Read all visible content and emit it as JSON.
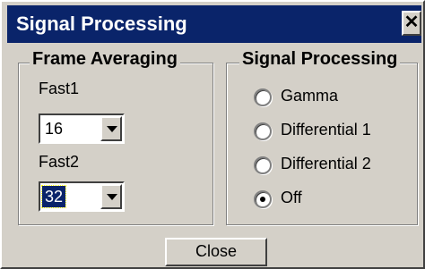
{
  "window": {
    "title": "Signal Processing",
    "close_glyph": "✕"
  },
  "frame_averaging": {
    "legend": "Frame Averaging",
    "fast1": {
      "label": "Fast1",
      "value": "16"
    },
    "fast2": {
      "label": "Fast2",
      "value": "32"
    }
  },
  "signal_processing": {
    "legend": "Signal Processing",
    "options": [
      {
        "label": "Gamma",
        "selected": false
      },
      {
        "label": "Differential 1",
        "selected": false
      },
      {
        "label": "Differential 2",
        "selected": false
      },
      {
        "label": "Off",
        "selected": true
      }
    ]
  },
  "buttons": {
    "close": "Close"
  },
  "icons": {
    "dropdown": "chevron-down-icon",
    "close": "close-icon"
  },
  "colors": {
    "titlebar": "#0a246a",
    "face": "#d4d0c8"
  }
}
